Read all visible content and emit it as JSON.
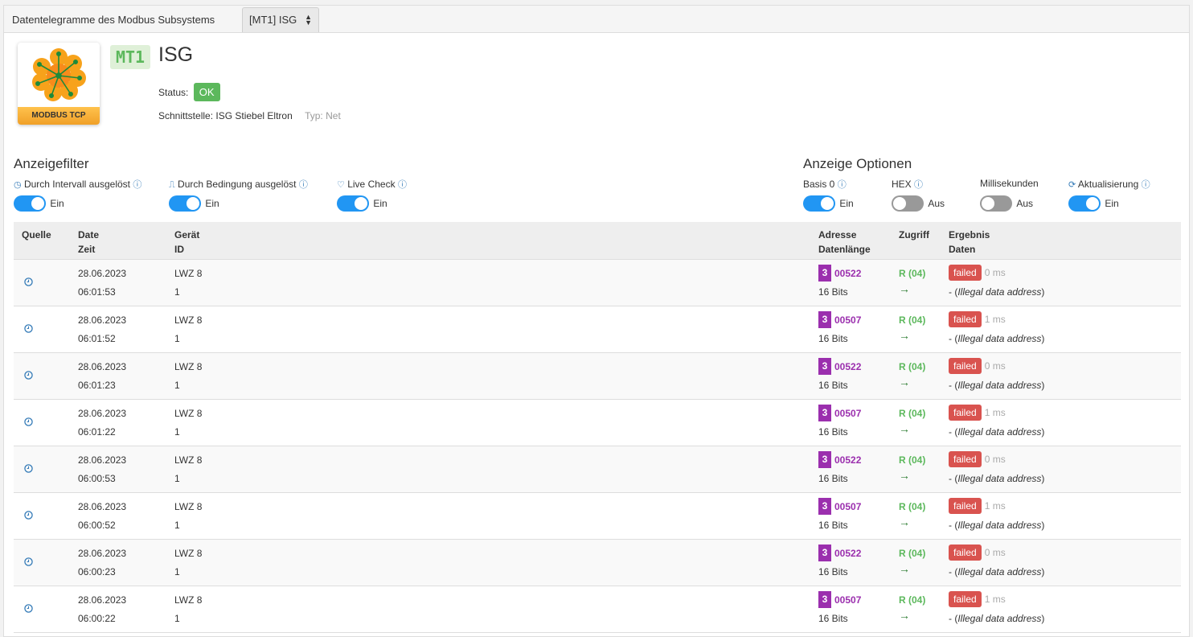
{
  "topbar": {
    "title": "Datentelegramme des Modbus Subsystems",
    "select_value": "[MT1] ISG"
  },
  "device": {
    "logo_label": "MODBUS TCP",
    "badge": "MT1",
    "name": "ISG",
    "status_label": "Status:",
    "status_value": "OK",
    "interface_label": "Schnittstelle: ISG Stiebel Eltron",
    "typ": "Typ: Net"
  },
  "filters": {
    "heading": "Anzeigefilter",
    "items": [
      {
        "label": "Durch Intervall ausgelöst",
        "state": "Ein"
      },
      {
        "label": "Durch Bedingung ausgelöst",
        "state": "Ein"
      },
      {
        "label": "Live Check",
        "state": "Ein"
      }
    ]
  },
  "options": {
    "heading": "Anzeige Optionen",
    "items": [
      {
        "label": "Basis 0",
        "state": "Ein"
      },
      {
        "label": "HEX",
        "state": "Aus"
      },
      {
        "label": "Millisekunden",
        "state": "Aus"
      },
      {
        "label": "Aktualisierung",
        "state": "Ein"
      }
    ]
  },
  "table": {
    "headers": {
      "quelle": "Quelle",
      "date": "Date",
      "zeit": "Zeit",
      "geraet": "Gerät",
      "id": "ID",
      "adresse": "Adresse",
      "datenlaenge": "Datenlänge",
      "zugriff": "Zugriff",
      "ergebnis": "Ergebnis",
      "daten": "Daten"
    },
    "rows": [
      {
        "date": "28.06.2023",
        "time": "06:01:53",
        "device": "LWZ 8",
        "id": "1",
        "reg": "3",
        "addr": "00522",
        "len": "16 Bits",
        "access": "R (04)",
        "arrow": "→",
        "result": "failed",
        "ms": "0 ms",
        "data_prefix": "- (",
        "data_err": "Illegal data address",
        "data_suffix": ")"
      },
      {
        "date": "28.06.2023",
        "time": "06:01:52",
        "device": "LWZ 8",
        "id": "1",
        "reg": "3",
        "addr": "00507",
        "len": "16 Bits",
        "access": "R (04)",
        "arrow": "→",
        "result": "failed",
        "ms": "1 ms",
        "data_prefix": "- (",
        "data_err": "Illegal data address",
        "data_suffix": ")"
      },
      {
        "date": "28.06.2023",
        "time": "06:01:23",
        "device": "LWZ 8",
        "id": "1",
        "reg": "3",
        "addr": "00522",
        "len": "16 Bits",
        "access": "R (04)",
        "arrow": "→",
        "result": "failed",
        "ms": "0 ms",
        "data_prefix": "- (",
        "data_err": "Illegal data address",
        "data_suffix": ")"
      },
      {
        "date": "28.06.2023",
        "time": "06:01:22",
        "device": "LWZ 8",
        "id": "1",
        "reg": "3",
        "addr": "00507",
        "len": "16 Bits",
        "access": "R (04)",
        "arrow": "→",
        "result": "failed",
        "ms": "1 ms",
        "data_prefix": "- (",
        "data_err": "Illegal data address",
        "data_suffix": ")"
      },
      {
        "date": "28.06.2023",
        "time": "06:00:53",
        "device": "LWZ 8",
        "id": "1",
        "reg": "3",
        "addr": "00522",
        "len": "16 Bits",
        "access": "R (04)",
        "arrow": "→",
        "result": "failed",
        "ms": "0 ms",
        "data_prefix": "- (",
        "data_err": "Illegal data address",
        "data_suffix": ")"
      },
      {
        "date": "28.06.2023",
        "time": "06:00:52",
        "device": "LWZ 8",
        "id": "1",
        "reg": "3",
        "addr": "00507",
        "len": "16 Bits",
        "access": "R (04)",
        "arrow": "→",
        "result": "failed",
        "ms": "1 ms",
        "data_prefix": "- (",
        "data_err": "Illegal data address",
        "data_suffix": ")"
      },
      {
        "date": "28.06.2023",
        "time": "06:00:23",
        "device": "LWZ 8",
        "id": "1",
        "reg": "3",
        "addr": "00522",
        "len": "16 Bits",
        "access": "R (04)",
        "arrow": "→",
        "result": "failed",
        "ms": "0 ms",
        "data_prefix": "- (",
        "data_err": "Illegal data address",
        "data_suffix": ")"
      },
      {
        "date": "28.06.2023",
        "time": "06:00:22",
        "device": "LWZ 8",
        "id": "1",
        "reg": "3",
        "addr": "00507",
        "len": "16 Bits",
        "access": "R (04)",
        "arrow": "→",
        "result": "failed",
        "ms": "1 ms",
        "data_prefix": "- (",
        "data_err": "Illegal data address",
        "data_suffix": ")"
      }
    ]
  },
  "colors": {
    "accent": "#2196f3",
    "ok": "#5cb85c",
    "failed": "#d9534f",
    "register": "#9b2fae"
  }
}
